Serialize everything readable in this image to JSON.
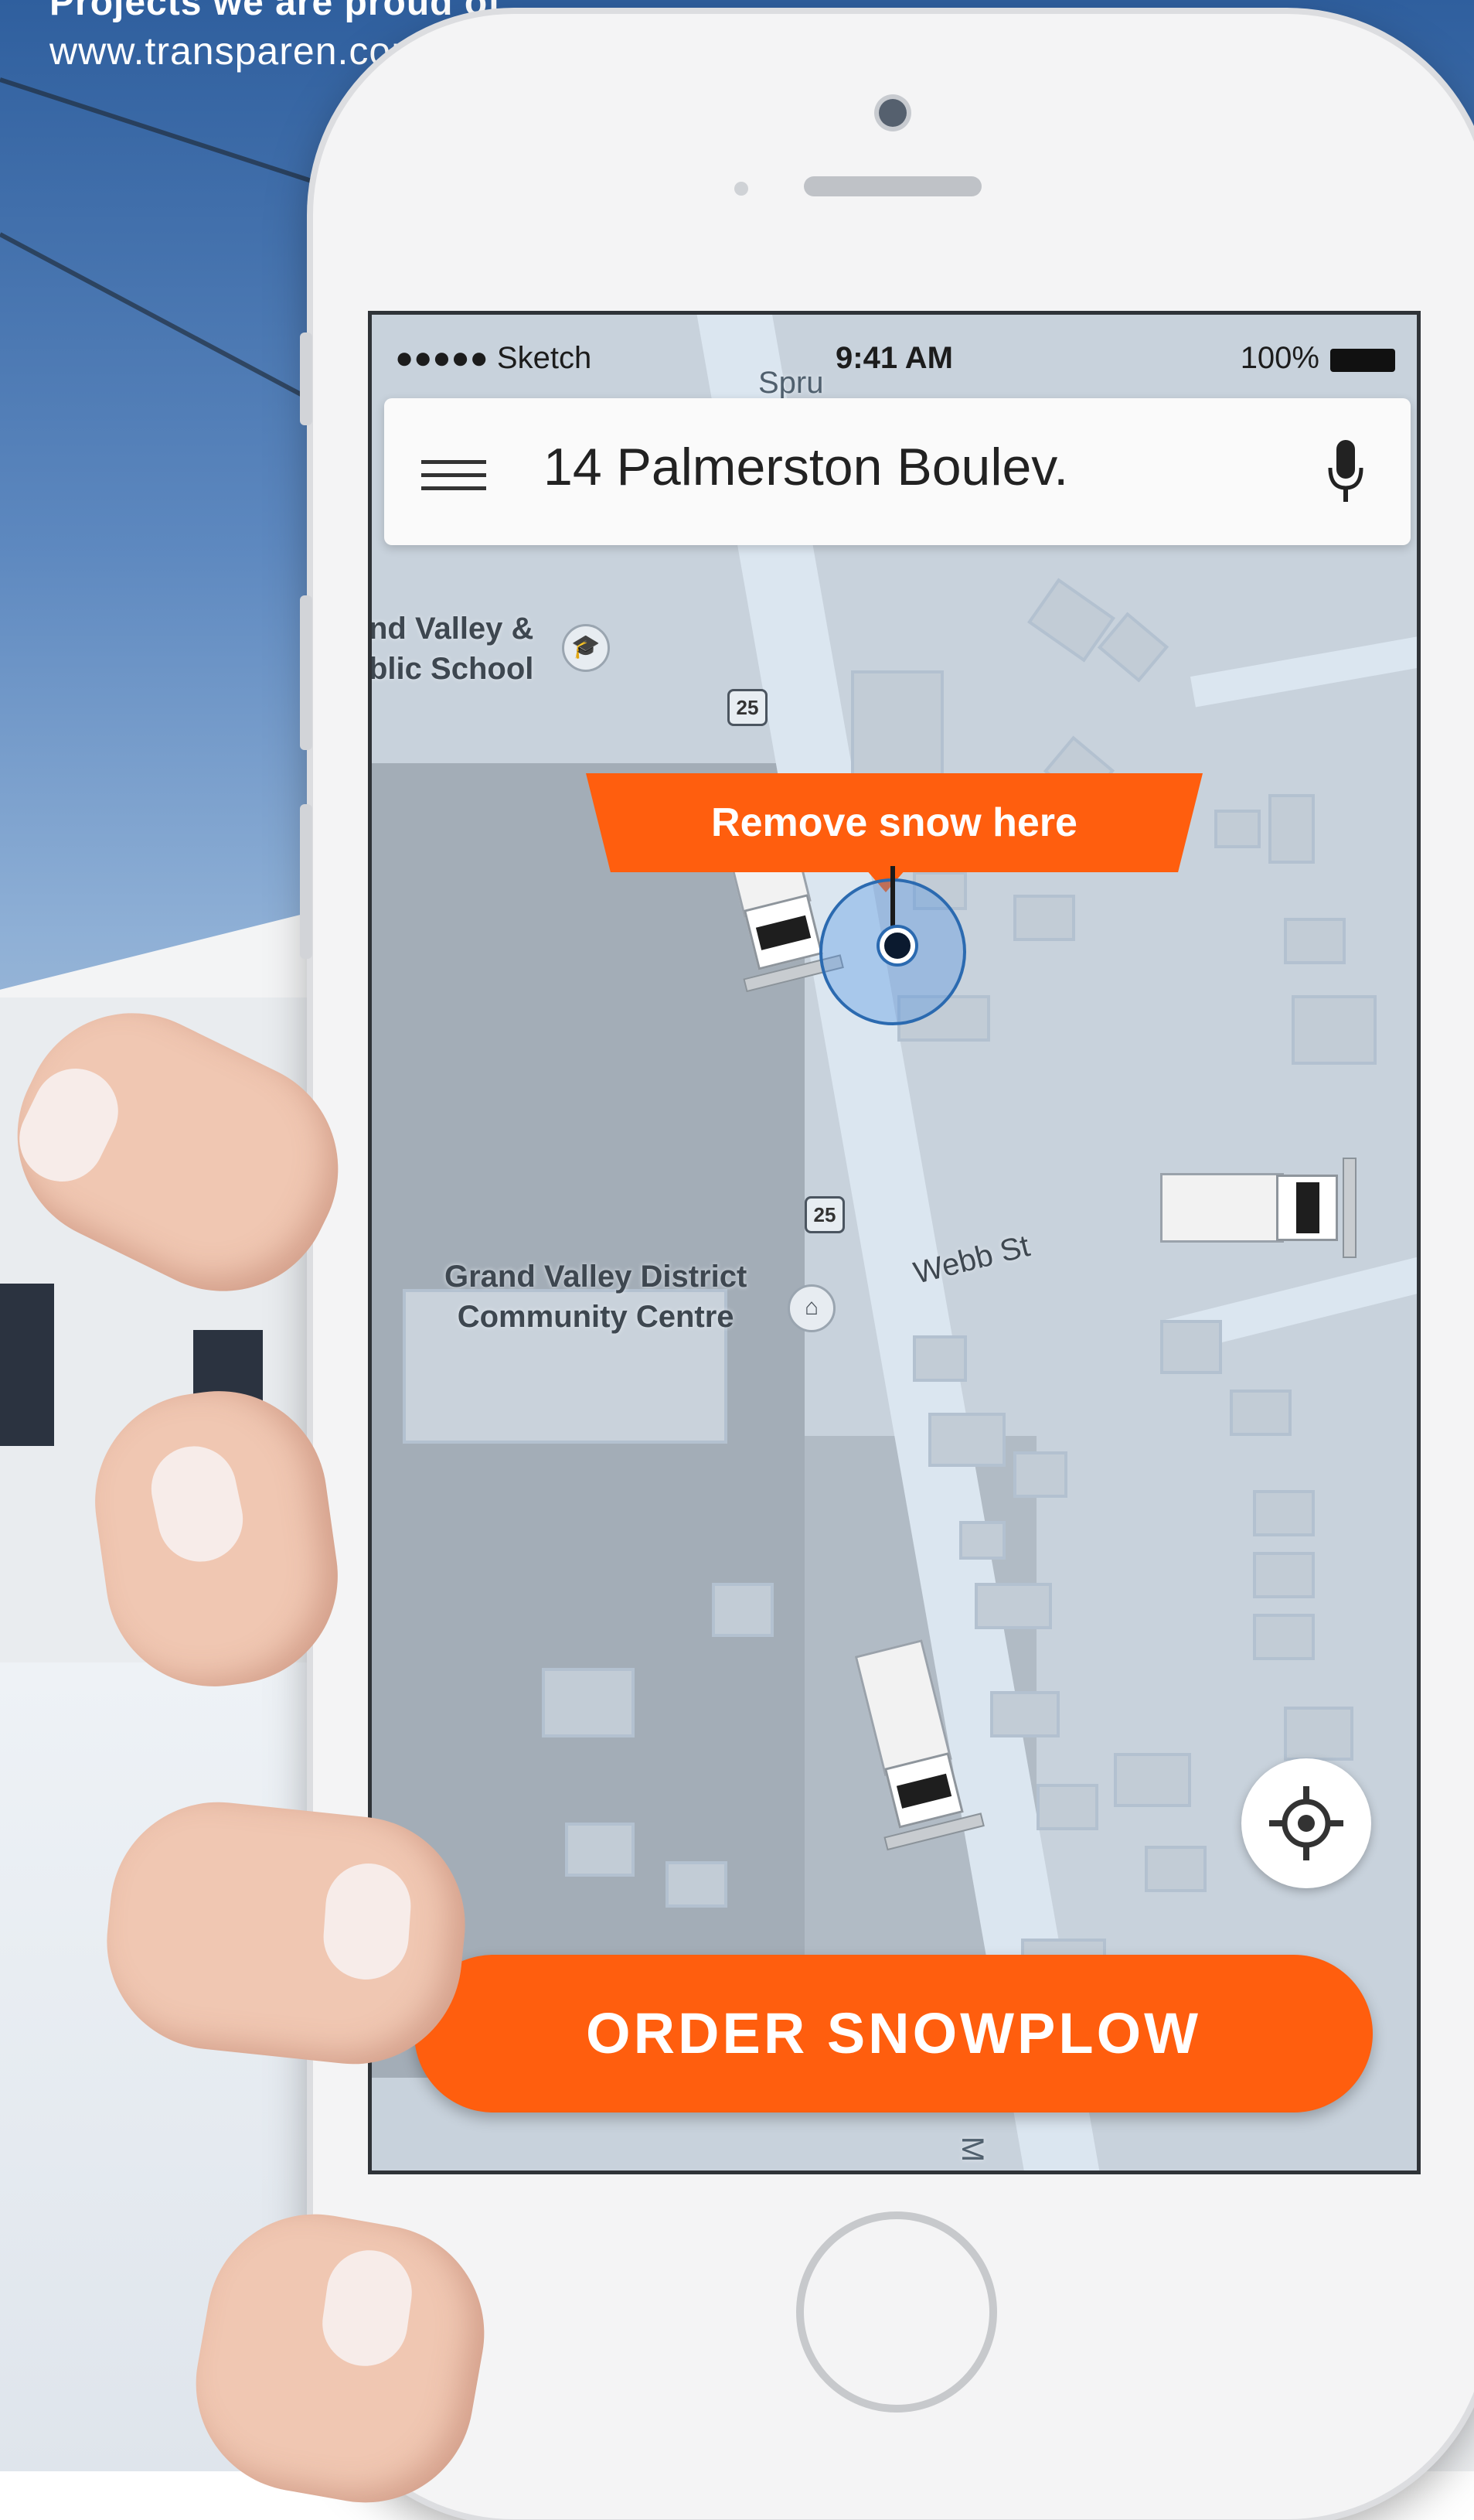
{
  "banner": {
    "title": "Projects we are proud of",
    "url": "www.transparen.com"
  },
  "status_bar": {
    "carrier": "●●●●● Sketch",
    "time": "9:41 AM",
    "battery": "100%"
  },
  "search": {
    "address": "14 Palmerston Boulev."
  },
  "map": {
    "labels": {
      "school": [
        "nd Valley &",
        "blic School"
      ],
      "centre": [
        "Grand Valley District",
        "Community Centre"
      ],
      "street_webb": "Webb St",
      "street_top": "Spru",
      "street_bottom": "M"
    },
    "route_markers": [
      "25",
      "25"
    ]
  },
  "pin": {
    "label": "Remove snow here"
  },
  "actions": {
    "order": "ORDER SNOWPLOW"
  },
  "colors": {
    "accent": "#ff5e0e",
    "pin_ring": "#2b6ab0",
    "map_bg": "#c8d2dc"
  }
}
